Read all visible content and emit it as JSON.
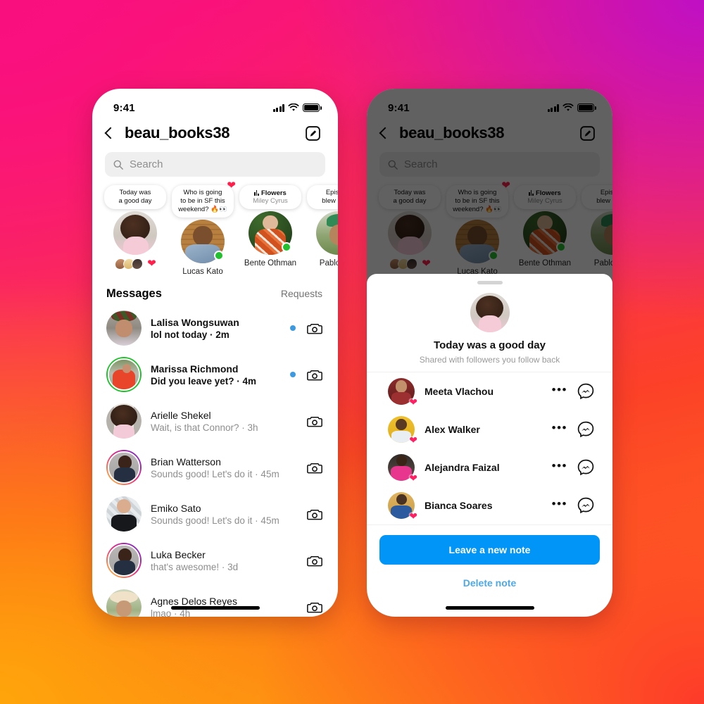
{
  "background": {
    "colors": [
      "#f8117c",
      "#bf10c4",
      "#fe3a2a",
      "#ffa50a"
    ]
  },
  "accent": {
    "blue": "#0095f6",
    "unread_dot": "#3d9ae0",
    "heart": "#ff1f4a",
    "online": "#22c02f",
    "link": "#4fa8e8"
  },
  "status_bar": {
    "time": "9:41",
    "signal_icon": "signal-bars-icon",
    "wifi_icon": "wifi-icon",
    "battery_icon": "battery-icon"
  },
  "header": {
    "back_icon": "back-chevron-icon",
    "title": "beau_books38",
    "compose_icon": "compose-icon"
  },
  "search": {
    "placeholder": "Search",
    "value": "",
    "icon": "search-icon"
  },
  "notes_tray": {
    "items": [
      {
        "kind": "text",
        "lines": [
          "Today was",
          "a good day"
        ],
        "name": "",
        "is_self": true,
        "has_heart": false,
        "online": false,
        "avatar": "p-self",
        "self_reactors": [
          "p-m1",
          "p-m2",
          "p-m3"
        ],
        "self_heart": "❤"
      },
      {
        "kind": "text",
        "lines": [
          "Who is going",
          "to be in SF this",
          "weekend? 🔥👀"
        ],
        "name": "Lucas Kato",
        "is_self": false,
        "has_heart": true,
        "online": true,
        "avatar": "p-lucas"
      },
      {
        "kind": "music",
        "track": "Flowers",
        "artist": "Miley Cyrus",
        "name": "Bente Othman",
        "is_self": false,
        "has_heart": false,
        "online": true,
        "avatar": "p-bente"
      },
      {
        "kind": "text",
        "lines": [
          "Episode",
          "blew my m"
        ],
        "name": "Pablo Mor",
        "is_self": false,
        "has_heart": false,
        "online": false,
        "avatar": "p-pablo"
      }
    ]
  },
  "messages": {
    "heading": "Messages",
    "requests_label": "Requests",
    "rows": [
      {
        "name": "Lalisa Wongsuwan",
        "preview": "lol not today · 2m",
        "unread": true,
        "ring": "ring-none",
        "avatar": "p-lalisa",
        "camera_icon": "camera-icon"
      },
      {
        "name": "Marissa Richmond",
        "preview": "Did you leave yet? · 4m",
        "unread": true,
        "ring": "ring-green",
        "avatar": "p-marissa",
        "camera_icon": "camera-icon"
      },
      {
        "name": "Arielle Shekel",
        "preview": "Wait, is that Connor? · 3h",
        "unread": false,
        "ring": "ring-none",
        "avatar": "p-arielle",
        "camera_icon": "camera-icon"
      },
      {
        "name": "Brian Watterson",
        "preview": "Sounds good! Let's do it · 45m",
        "unread": false,
        "ring": "ring-grad",
        "avatar": "p-brian",
        "camera_icon": "camera-icon"
      },
      {
        "name": "Emiko Sato",
        "preview": "Sounds good! Let's do it · 45m",
        "unread": false,
        "ring": "ring-none",
        "avatar": "p-emiko",
        "camera_icon": "camera-icon"
      },
      {
        "name": "Luka Becker",
        "preview": "that's awesome! · 3d",
        "unread": false,
        "ring": "ring-grad",
        "avatar": "p-brian",
        "camera_icon": "camera-icon"
      },
      {
        "name": "Agnes Delos Reyes",
        "preview": "lmao · 4h",
        "unread": false,
        "ring": "ring-none",
        "avatar": "p-agnes",
        "camera_icon": "camera-icon"
      }
    ]
  },
  "note_sheet": {
    "grab_handle": "drag-handle",
    "avatar": "p-self",
    "title": "Today was a good day",
    "subtitle": "Shared with followers you follow back",
    "replies": [
      {
        "name": "Meeta Vlachou",
        "avatar": "p-meeta",
        "heart": "❤",
        "more_icon": "more-options-icon",
        "messenger_icon": "messenger-icon"
      },
      {
        "name": "Alex Walker",
        "avatar": "p-alex",
        "heart": "❤",
        "more_icon": "more-options-icon",
        "messenger_icon": "messenger-icon"
      },
      {
        "name": "Alejandra Faizal",
        "avatar": "p-alejandra",
        "heart": "❤",
        "more_icon": "more-options-icon",
        "messenger_icon": "messenger-icon"
      },
      {
        "name": "Bianca Soares",
        "avatar": "p-bianca",
        "heart": "❤",
        "more_icon": "more-options-icon",
        "messenger_icon": "messenger-icon"
      }
    ],
    "primary_button": "Leave a new note",
    "secondary_link": "Delete note"
  }
}
